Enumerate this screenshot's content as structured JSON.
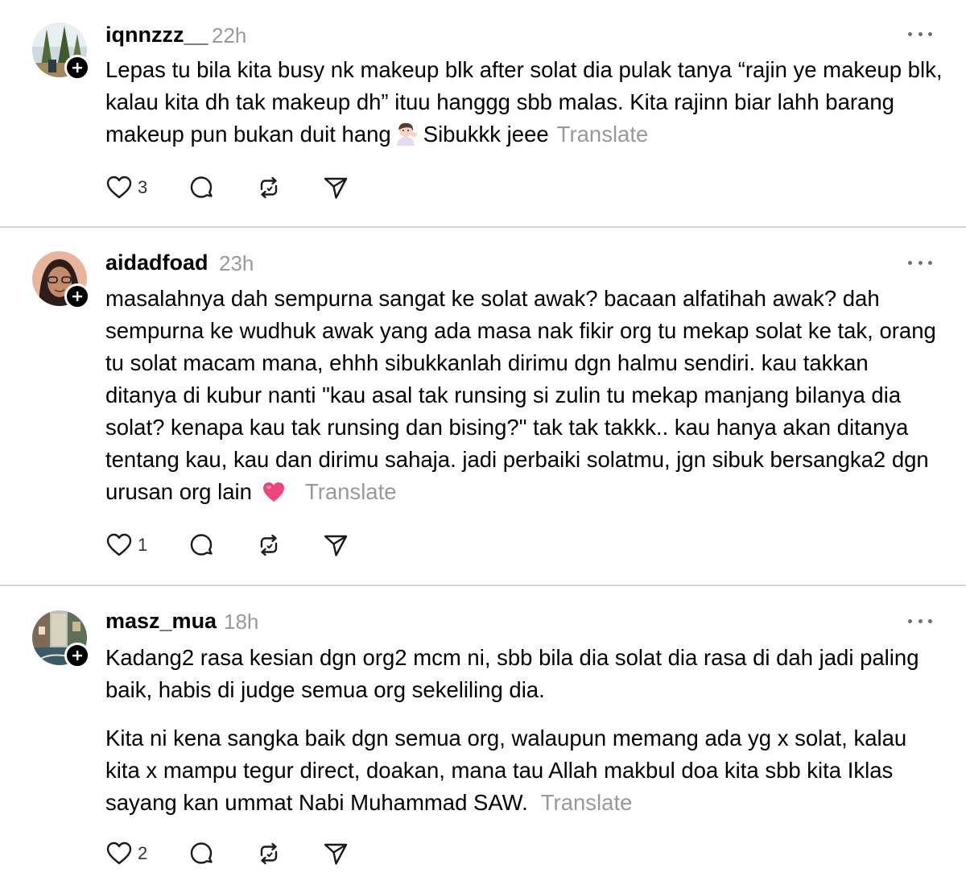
{
  "posts": [
    {
      "username": "iqnnzzz__",
      "time": "22h",
      "text": [
        "Lepas tu bila kita busy nk makeup blk after solat dia pulak tanya “rajin ye makeup blk, kalau kita dh tak makeup dh” ituu hanggg sbb malas. Kita rajinn biar lahh barang makeup pun bukan duit hang"
      ],
      "text_after_emoji": "Sibukkk jeee",
      "emoji": "woman-tipping-hand-emoji",
      "translate_label": "Translate",
      "likes": "3"
    },
    {
      "username": "aidadfoad",
      "time": "23h",
      "text": [
        "masalahnya dah sempurna sangat ke solat awak? bacaan alfatihah awak? dah sempurna ke wudhuk awak yang ada masa nak fikir org tu mekap solat ke tak, orang tu solat macam mana, ehhh sibukkanlah dirimu dgn halmu sendiri. kau takkan ditanya di kubur nanti \"kau asal tak runsing si zulin tu mekap manjang bilanya dia solat? kenapa kau tak runsing dan bising?\" tak tak takkk.. kau hanya akan ditanya tentang kau, kau dan dirimu sahaja. jadi perbaiki solatmu, jgn sibuk bersangka2 dgn urusan org lain"
      ],
      "emoji": "pink-heart-emoji",
      "translate_label": "Translate",
      "likes": "1"
    },
    {
      "username": "masz_mua",
      "time": "18h",
      "text": [
        "Kadang2 rasa kesian dgn org2 mcm ni, sbb bila dia solat dia rasa di dah jadi paling baik, habis di judge semua org sekeliling dia.",
        "Kita ni kena sangka baik dgn semua org, walaupun memang ada yg x solat, kalau kita x mampu tegur direct, doakan, mana tau Allah makbul doa kita sbb kita Iklas sayang kan ummat Nabi Muhammad SAW."
      ],
      "translate_label": "Translate",
      "likes": "2"
    }
  ],
  "icons": {
    "like": "heart-icon",
    "reply": "comment-bubble-icon",
    "repost": "repost-icon",
    "share": "send-icon",
    "more": "more-options-icon",
    "follow": "plus-icon"
  },
  "colors": {
    "text": "#000000",
    "muted": "#999999",
    "divider": "#d4d4d4",
    "heart_emoji": "#f0457a"
  }
}
